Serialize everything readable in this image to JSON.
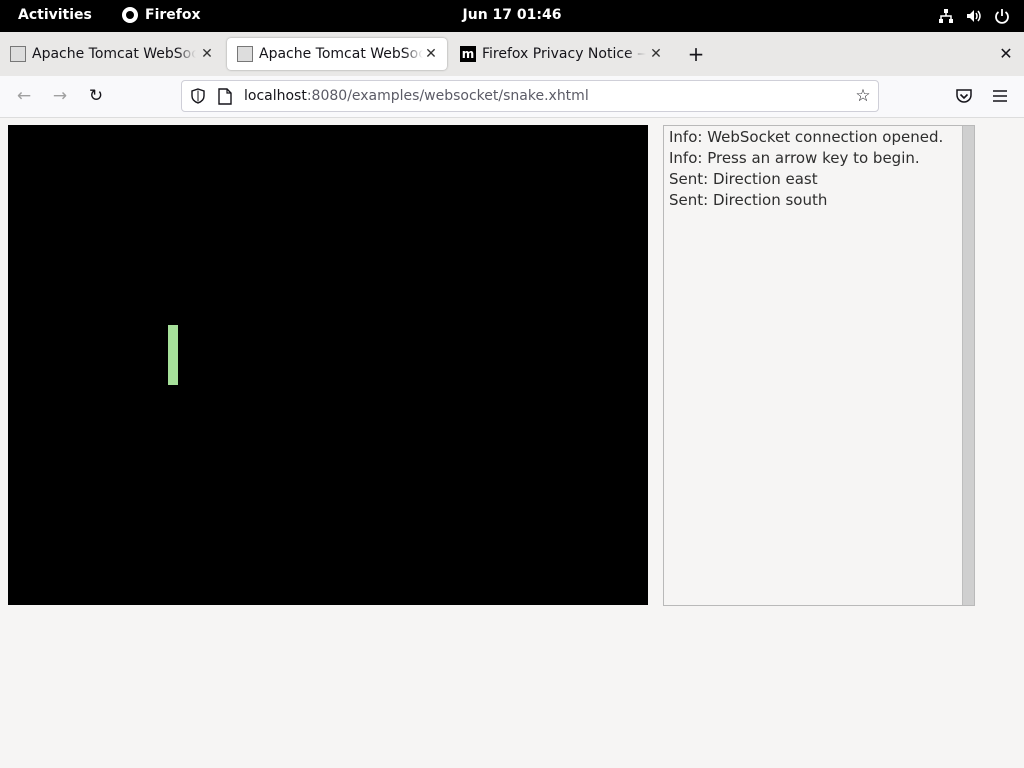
{
  "system_bar": {
    "activities": "Activities",
    "app_name": "Firefox",
    "datetime": "Jun 17  01:46",
    "icons": [
      "network-icon",
      "volume-icon",
      "power-icon"
    ]
  },
  "tabs": [
    {
      "title": "Apache Tomcat WebSocket Examples: Multiplayer Snake",
      "favicon": "tomcat-icon",
      "active": false
    },
    {
      "title": "Apache Tomcat WebSocket Examples: Multiplayer Snake",
      "favicon": "tomcat-icon",
      "active": true
    },
    {
      "title": "Firefox Privacy Notice — Mozilla",
      "favicon": "mozilla-icon",
      "favicon_text": "m",
      "active": false
    }
  ],
  "toolbar": {
    "new_tab": "+",
    "close_window": "✕",
    "back": "←",
    "forward": "→",
    "reload": "↻",
    "url_host": "localhost",
    "url_path": ":8080/examples/websocket/snake.xhtml",
    "bookmark_star": "☆"
  },
  "game": {
    "snake_color": "#a6e09a",
    "background": "#000000"
  },
  "console": {
    "messages": [
      "Info: WebSocket connection opened.",
      "Info: Press an arrow key to begin.",
      "Sent: Direction east",
      "Sent: Direction south"
    ]
  }
}
